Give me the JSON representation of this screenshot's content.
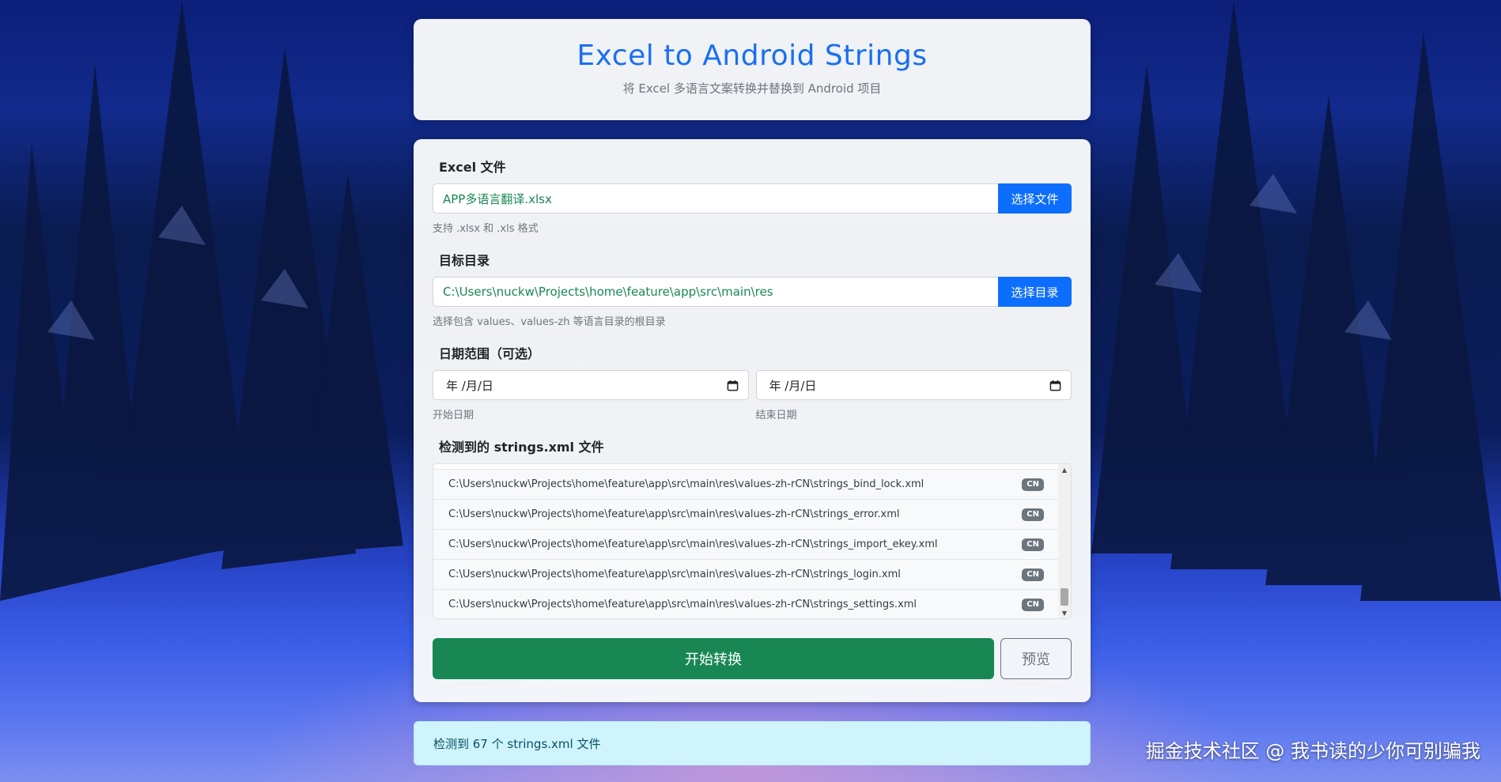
{
  "header": {
    "title": "Excel to Android Strings",
    "subtitle": "将 Excel 多语言文案转换并替换到 Android 项目"
  },
  "excel_file": {
    "label": "Excel 文件",
    "value": "APP多语言翻译.xlsx",
    "button": "选择文件",
    "help": "支持 .xlsx 和 .xls 格式"
  },
  "target_dir": {
    "label": "目标目录",
    "value": "C:\\Users\\nuckw\\Projects\\home\\feature\\app\\src\\main\\res",
    "button": "选择目录",
    "help": "选择包含 values、values-zh 等语言目录的根目录"
  },
  "date_range": {
    "label": "日期范围（可选）",
    "start_placeholder": "年 /月/日",
    "end_placeholder": "年 /月/日",
    "start_help": "开始日期",
    "end_help": "结束日期"
  },
  "detected": {
    "label": "检测到的 strings.xml 文件",
    "files": [
      {
        "path": "C:\\Users\\nuckw\\Projects\\home\\feature\\app\\src\\main\\res\\values-zh-rCN\\strings_bind_lock.xml",
        "badge": "CN"
      },
      {
        "path": "C:\\Users\\nuckw\\Projects\\home\\feature\\app\\src\\main\\res\\values-zh-rCN\\strings_error.xml",
        "badge": "CN"
      },
      {
        "path": "C:\\Users\\nuckw\\Projects\\home\\feature\\app\\src\\main\\res\\values-zh-rCN\\strings_import_ekey.xml",
        "badge": "CN"
      },
      {
        "path": "C:\\Users\\nuckw\\Projects\\home\\feature\\app\\src\\main\\res\\values-zh-rCN\\strings_login.xml",
        "badge": "CN"
      },
      {
        "path": "C:\\Users\\nuckw\\Projects\\home\\feature\\app\\src\\main\\res\\values-zh-rCN\\strings_settings.xml",
        "badge": "CN"
      }
    ]
  },
  "actions": {
    "convert": "开始转换",
    "preview": "预览"
  },
  "status": {
    "message": "检测到 67 个 strings.xml 文件"
  },
  "watermark": "掘金技术社区 @ 我书读的少你可别骗我",
  "colors": {
    "primary": "#0d6efd",
    "success": "#198754",
    "title": "#1a6ff0",
    "info_bg": "#cff4fc"
  }
}
